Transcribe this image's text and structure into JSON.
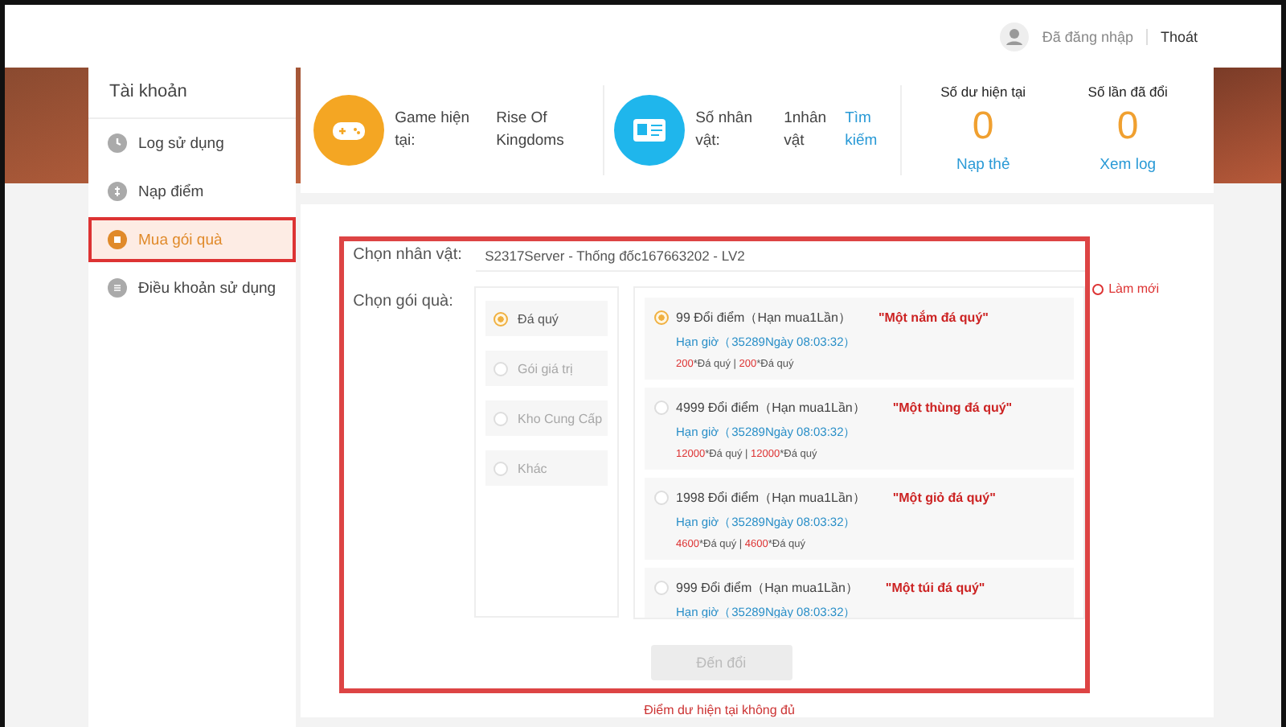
{
  "header": {
    "user_label": "Đã đăng nhập",
    "logout": "Thoát"
  },
  "sidebar": {
    "title": "Tài khoản",
    "items": [
      {
        "label": "Log sử dụng",
        "selected": false,
        "kind": "clock"
      },
      {
        "label": "Nạp điểm",
        "selected": false,
        "kind": "coin"
      },
      {
        "label": "Mua gói quà",
        "selected": true,
        "kind": "gift"
      },
      {
        "label": "Điều khoản sử dụng",
        "selected": false,
        "kind": "doc"
      }
    ]
  },
  "stats": {
    "game": {
      "label": "Game hiện tại:",
      "value": "Rise Of Kingdoms"
    },
    "characters": {
      "label": "Số nhân vật:",
      "value": "1nhân vật",
      "link": "Tìm kiếm"
    },
    "balance": {
      "label": "Số dư hiện tại",
      "value": "0",
      "link": "Nạp thẻ"
    },
    "exchanges": {
      "label": "Số lần đã đổi",
      "value": "0",
      "link": "Xem log"
    }
  },
  "form": {
    "character_label": "Chọn nhân vật:",
    "character_value": "S2317Server - Thống đốc167663202 - LV2",
    "package_label": "Chọn gói quà:",
    "refresh": "Làm mới",
    "categories": [
      {
        "label": "Đá quý",
        "selected": true,
        "disabled": false
      },
      {
        "label": "Gói giá trị",
        "selected": false,
        "disabled": true
      },
      {
        "label": "Kho Cung Cấp",
        "selected": false,
        "disabled": true
      },
      {
        "label": "Khác",
        "selected": false,
        "disabled": true
      }
    ],
    "offers": [
      {
        "title": "99 Đổi điểm（Hạn mua1Lần）",
        "name": "\"Một nắm đá quý\"",
        "hold": "Hạn giờ（35289Ngày 08:03:32）",
        "selected": true,
        "separator": "|",
        "price": [
          {
            "amount": "200",
            "unit": "*Đá quý"
          },
          {
            "amount": "200",
            "unit": "*Đá quý"
          }
        ]
      },
      {
        "title": "4999 Đổi điểm（Hạn mua1Lần）",
        "name": "\"Một thùng đá quý\"",
        "hold": "Hạn giờ（35289Ngày 08:03:32）",
        "selected": false,
        "separator": "|",
        "price": [
          {
            "amount": "12000",
            "unit": "*Đá quý"
          },
          {
            "amount": "12000",
            "unit": "*Đá quý"
          }
        ]
      },
      {
        "title": "1998 Đổi điểm（Hạn mua1Lần）",
        "name": "\"Một giỏ đá quý\"",
        "hold": "Hạn giờ（35289Ngày 08:03:32）",
        "selected": false,
        "separator": "|",
        "price": [
          {
            "amount": "4600",
            "unit": "*Đá quý"
          },
          {
            "amount": "4600",
            "unit": "*Đá quý"
          }
        ]
      },
      {
        "title": "999 Đổi điểm（Hạn mua1Lần）",
        "name": "\"Một túi đá quý\"",
        "hold": "Hạn giờ（35289Ngày 08:03:32）",
        "selected": false
      }
    ],
    "submit": {
      "label": "Đến đổi",
      "disabled": true
    },
    "error": "Điểm dư hiện tại không đủ"
  }
}
